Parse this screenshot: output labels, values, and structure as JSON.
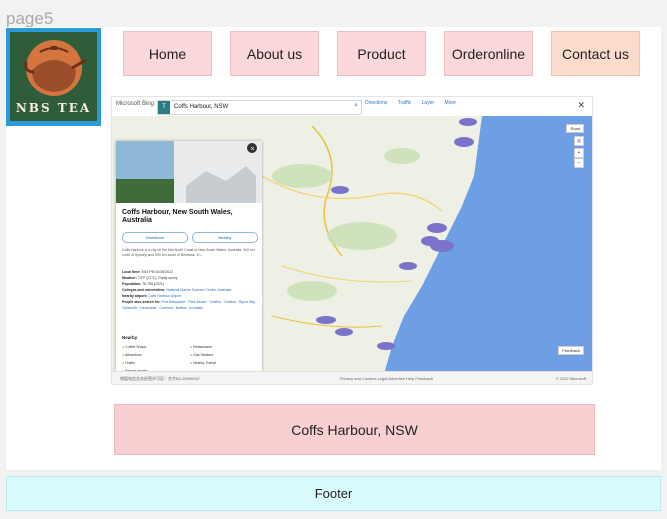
{
  "page": {
    "label": "page5"
  },
  "logo": {
    "text": "NBS TEA",
    "icon": "teapot-icon"
  },
  "nav": [
    {
      "label": "Home"
    },
    {
      "label": "About us"
    },
    {
      "label": "Product"
    },
    {
      "label": "Orderonline"
    },
    {
      "label": "Contact us"
    }
  ],
  "map": {
    "brand": "Microsoft Bing",
    "search_value": "Coffs Harbour, NSW",
    "search_tag": "T",
    "tools": [
      "Directions",
      "Traffic",
      "Layer",
      "More"
    ],
    "layer_button": "Road",
    "place_title": "Coffs Harbour, New South Wales, Australia",
    "directions_label": "Directions",
    "nearby_button_label": "Nearby",
    "description": "Coffs Harbour is a city on the Mid North Coast of New South Wales, Australia, 540 km north of Sydney, and 390 km south of Brisbane. It i...",
    "facts": {
      "local_time_label": "Local time:",
      "local_time": "5:53 PM 10/26/2022",
      "weather_label": "Weather:",
      "weather": "70°F (21°C), Partly sunny",
      "population_label": "Population:",
      "population": "78,759 (2021)",
      "colleges_label": "Colleges and universities:",
      "colleges": "National Marine Science Centre, Australia",
      "airport_label": "Nearby airport:",
      "airport": "Coffs Harbour Airport",
      "also_label": "People also search for:",
      "also": "Port Macquarie · Park Beach · Grafton · Grafton · Byron Bay · Tamworth · Newcastle · Corrimal · Ballina · Armidale"
    },
    "nearby_heading": "Nearby",
    "nearby_items": [
      "Coffee Shops",
      "Restaurants",
      "Attractions",
      "Gas Stations",
      "Hotels",
      "Nearby Transit",
      "Search nearby"
    ],
    "feedback_label": "Feedback",
    "footer_left": "增值电信业务经营许可证：合字B2-20090007",
    "footer_mid": "京公网安备11010802022657号",
    "footer_links": "Privacy and Cookies  Legal  Advertise  Help  Feedback",
    "footer_right": "© 2022 Microsoft"
  },
  "caption": "Coffs Harbour, NSW",
  "footer": "Footer"
}
